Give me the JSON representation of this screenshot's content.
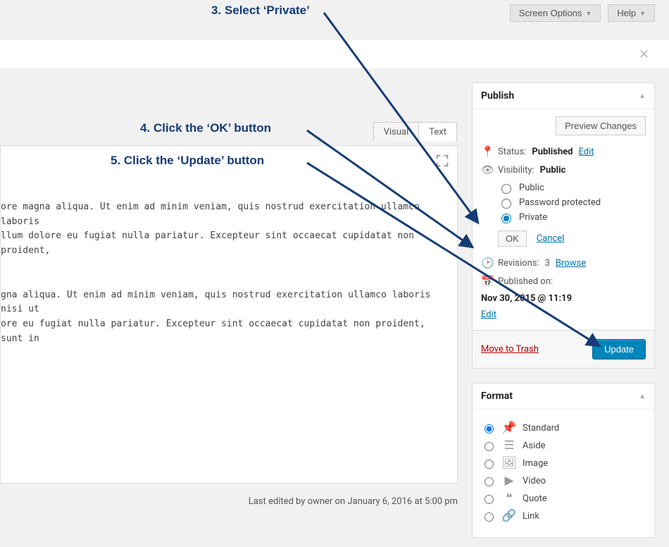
{
  "top": {
    "screen_options": "Screen Options",
    "help": "Help"
  },
  "editor": {
    "tabs": {
      "visual": "Visual",
      "text": "Text"
    },
    "content_l1": "ore magna aliqua. Ut enim ad minim veniam, quis nostrud exercitation ullamco laboris",
    "content_l2": "llum dolore eu fugiat nulla pariatur. Excepteur sint occaecat cupidatat non proident,",
    "content_l3": "gna aliqua. Ut enim ad minim veniam, quis nostrud exercitation ullamco laboris nisi ut",
    "content_l4": "ore eu fugiat nulla pariatur. Excepteur sint occaecat cupidatat non proident, sunt in",
    "last_edited": "Last edited by owner on January 6, 2016 at 5:00 pm"
  },
  "publish": {
    "title": "Publish",
    "preview": "Preview Changes",
    "status_label": "Status:",
    "status_value": "Published",
    "edit": "Edit",
    "visibility_label": "Visibility:",
    "visibility_value": "Public",
    "opt_public": "Public",
    "opt_password": "Password protected",
    "opt_private": "Private",
    "ok": "OK",
    "cancel": "Cancel",
    "revisions_label": "Revisions:",
    "revisions_count": "3",
    "browse": "Browse",
    "published_on_label": "Published on:",
    "published_on_value": "Nov 30, 2015 @ 11:19",
    "trash": "Move to Trash",
    "update": "Update"
  },
  "format": {
    "title": "Format",
    "standard": "Standard",
    "aside": "Aside",
    "image": "Image",
    "video": "Video",
    "quote": "Quote",
    "link": "Link"
  },
  "annotations": {
    "s3": "3. Select ‘Private’",
    "s4": "4. Click the ‘OK’ button",
    "s5": "5. Click the ‘Update’ button"
  }
}
